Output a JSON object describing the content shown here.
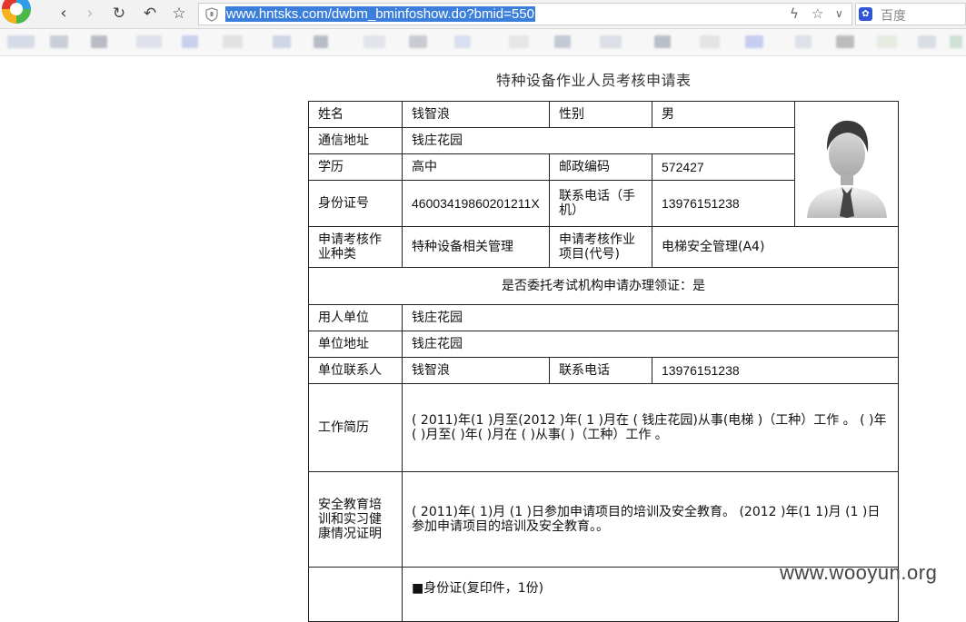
{
  "browser": {
    "url": "www.hntsks.com/dwbm_bminfoshow.do?bmid=550",
    "search_placeholder": "百度",
    "icons": [
      "app-logo-icon",
      "back-icon",
      "forward-icon",
      "reload-icon",
      "undo-icon",
      "star-icon",
      "shield-icon",
      "lightning-icon",
      "star-icon",
      "chevron-down-icon",
      "baidu-paw-icon"
    ]
  },
  "page": {
    "title": "特种设备作业人员考核申请表",
    "watermark": "www.wooyun.org"
  },
  "form": {
    "name_label": "姓名",
    "name_value": "钱智浪",
    "gender_label": "性别",
    "gender_value": "男",
    "address_label": "通信地址",
    "address_value": "钱庄花园",
    "education_label": "学历",
    "education_value": "高中",
    "postcode_label": "邮政编码",
    "postcode_value": "572427",
    "id_label": "身份证号",
    "id_value": "46003419860201211X",
    "phone_label": "联系电话（手机）",
    "phone_value": "13976151238",
    "category_label": "申请考核作业种类",
    "category_value": "特种设备相关管理",
    "item_label": "申请考核作业项目(代号)",
    "item_value": "电梯安全管理(A4)",
    "entrust_text": "是否委托考试机构申请办理领证：是",
    "employer_label": "用人单位",
    "employer_value": "钱庄花园",
    "employer_address_label": "单位地址",
    "employer_address_value": "钱庄花园",
    "contact_label": "单位联系人",
    "contact_value": "钱智浪",
    "contact_phone_label": "联系电话",
    "contact_phone_value": "13976151238",
    "work_history_label": "工作简历",
    "work_history_value": "( 2011)年(1 )月至(2012 )年( 1 )月在 ( 钱庄花园)从事(电梯 )（工种）工作 。 ( )年( )月至( )年( )月在 ( )从事( )（工种）工作 。",
    "safety_label": "安全教育培训和实习健康情况证明",
    "safety_value": "( 2011)年( 1)月 (1 )日参加申请项目的培训及安全教育。 (2012 )年(1 1)月 (1 )日参加申请项目的培训及安全教育。。",
    "attachment_item": "■身份证(复印件，1份)"
  },
  "colors": {
    "url_highlight": "#3b7fdb",
    "border": "#222222",
    "text": "#111111"
  }
}
